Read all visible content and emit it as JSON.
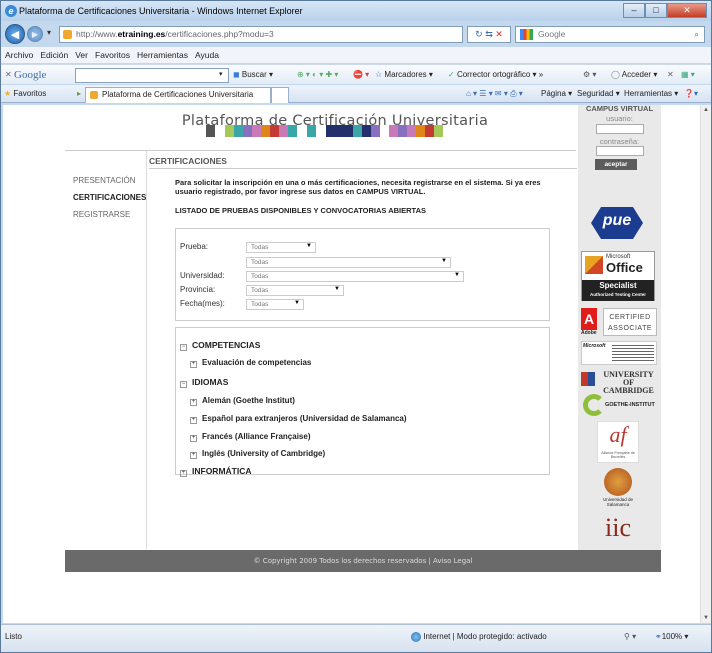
{
  "browser": {
    "window_title": "Plataforma de Certificaciones Universitaria - Windows Internet Explorer",
    "url_prefix": "http://www.",
    "url_host": "etraining.es",
    "url_path": "/certificaciones.php?modu=3",
    "search_placeholder": "Google",
    "menu": [
      "Archivo",
      "Edición",
      "Ver",
      "Favoritos",
      "Herramientas",
      "Ayuda"
    ],
    "google_toolbar": {
      "logo": "Google",
      "buscar": "Buscar",
      "marcadores": "Marcadores",
      "corrector": "Corrector ortográfico",
      "acceder": "Acceder"
    },
    "favorites_label": "Favoritos",
    "tab_title": "Plataforma de Certificaciones Universitaria",
    "command_bar": {
      "pagina": "Página",
      "seguridad": "Seguridad",
      "herramientas": "Herramientas"
    },
    "status_left": "Listo",
    "status_zone": "Internet | Modo protegido: activado",
    "zoom": "100%"
  },
  "site": {
    "title": "Plataforma de Certificación Universitaria",
    "nav": [
      {
        "label": "PRESENTACIÓN",
        "active": false
      },
      {
        "label": "CERTIFICACIONES",
        "active": true
      },
      {
        "label": "REGISTRARSE",
        "active": false
      }
    ],
    "section_title": "CERTIFICACIONES",
    "intro": "Para solicitar la inscripción en una o más certificaciones, necesita registrarse en el sistema. Si ya eres usuario registrado, por favor ingrese sus datos en CAMPUS VIRTUAL.",
    "list_heading": "LISTADO DE PRUEBAS DISPONIBLES Y CONVOCATORIAS ABIERTAS",
    "filters": {
      "prueba_label": "Prueba:",
      "prueba_value": "Todas",
      "prueba_sub_value": "Todas",
      "universidad_label": "Universidad:",
      "universidad_value": "Todas",
      "provincia_label": "Provincia:",
      "provincia_value": "Todas",
      "fecha_label": "Fecha(mes):",
      "fecha_value": "Todas"
    },
    "categories": {
      "competencias": "COMPETENCIAS",
      "evaluacion": "Evaluación de competencias",
      "idiomas": "IDIOMAS",
      "aleman": "Alemán (Goethe Institut)",
      "espanol": "Español para extranjeros (Universidad de Salamanca)",
      "frances": "Francés (Alliance Française)",
      "ingles": "Inglés (University of Cambridge)",
      "informatica": "INFORMÁTICA"
    },
    "campus": {
      "title": "CAMPUS VIRTUAL",
      "usuario_label": "usuario:",
      "password_label": "contraseña:",
      "submit": "aceptar"
    },
    "logos": {
      "pue": "pue",
      "ms_brand": "Microsoft",
      "ms_product": "Office",
      "ms_specialist": "Specialist",
      "ms_center": "Authorized Testing Center",
      "adobe": "Adobe",
      "adobe_cert": "CERTIFIED ASSOCIATE",
      "ms_small": "Microsoft",
      "cambridge": "UNIVERSITY OF CAMBRIDGE",
      "goethe": "GOETHE-INSTITUT",
      "af": "af",
      "af_caption": "Alliance Française de Bruxelles",
      "salamanca": "Universidad de Salamanca",
      "iic": "iic"
    },
    "footer": "© Copyright 2009 Todos los derechos reservados | Aviso Legal",
    "colors": {
      "pink": "#c879b8",
      "teal": "#3aa6a8",
      "navy": "#23306b",
      "red": "#c53b33",
      "orange": "#e0851a",
      "purple": "#8870c0",
      "green": "#a6c85a",
      "gray": "#777777"
    }
  }
}
